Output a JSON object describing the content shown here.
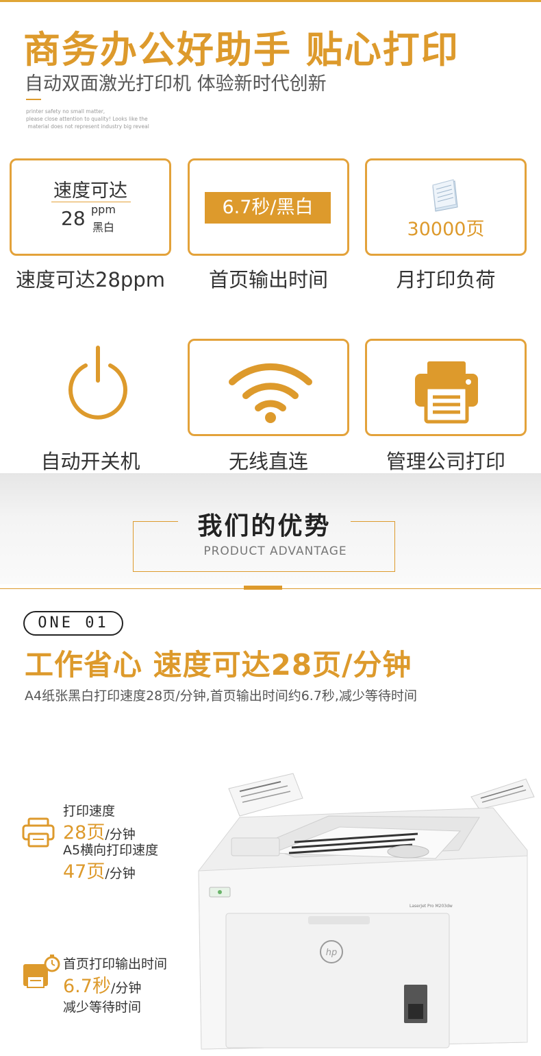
{
  "hero": {
    "title": "商务办公好助手 贴心打印",
    "subtitle": "自动双面激光打印机 体验新时代创新",
    "small_text": "printer safety no small matter,\nplease close attention to quality! Looks like the\n material does not represent industry big reveal"
  },
  "features": [
    {
      "speed_title": "速度可达",
      "speed_value": "28",
      "speed_unit": "ppm",
      "speed_mode": "黑白",
      "caption": "速度可达28ppm"
    },
    {
      "label": "6.7秒/黑白",
      "caption": "首页输出时间"
    },
    {
      "icon": "paper-stack-icon",
      "label": "30000页",
      "caption": "月打印负荷"
    },
    {
      "icon": "power-icon",
      "caption": "自动开关机"
    },
    {
      "icon": "wifi-icon",
      "caption": "无线直连"
    },
    {
      "icon": "printer-icon",
      "caption": "管理公司打印"
    }
  ],
  "advantage": {
    "title": "我们的优势",
    "subtitle": "PRODUCT ADVANTAGE"
  },
  "section_one": {
    "badge": "ONE 01",
    "title": "工作省心 速度可达28页/分钟",
    "description": "A4纸张黑白打印速度28页/分钟,首页输出时间约6.7秒,减少等待时间",
    "stats": {
      "a4_label": "打印速度",
      "a4_value": "28页",
      "a4_unit": "/分钟",
      "a5_label": "A5横向打印速度",
      "a5_value": "47页",
      "a5_unit": "/分钟",
      "first_label": "首页打印输出时间",
      "first_value": "6.7秒",
      "first_unit": "/分钟",
      "first_note": "减少等待时间"
    },
    "printer": {
      "model": "LaserJet Pro M203dw",
      "brand": "hp"
    }
  },
  "colors": {
    "accent": "#dd9a2c",
    "text": "#333333"
  }
}
